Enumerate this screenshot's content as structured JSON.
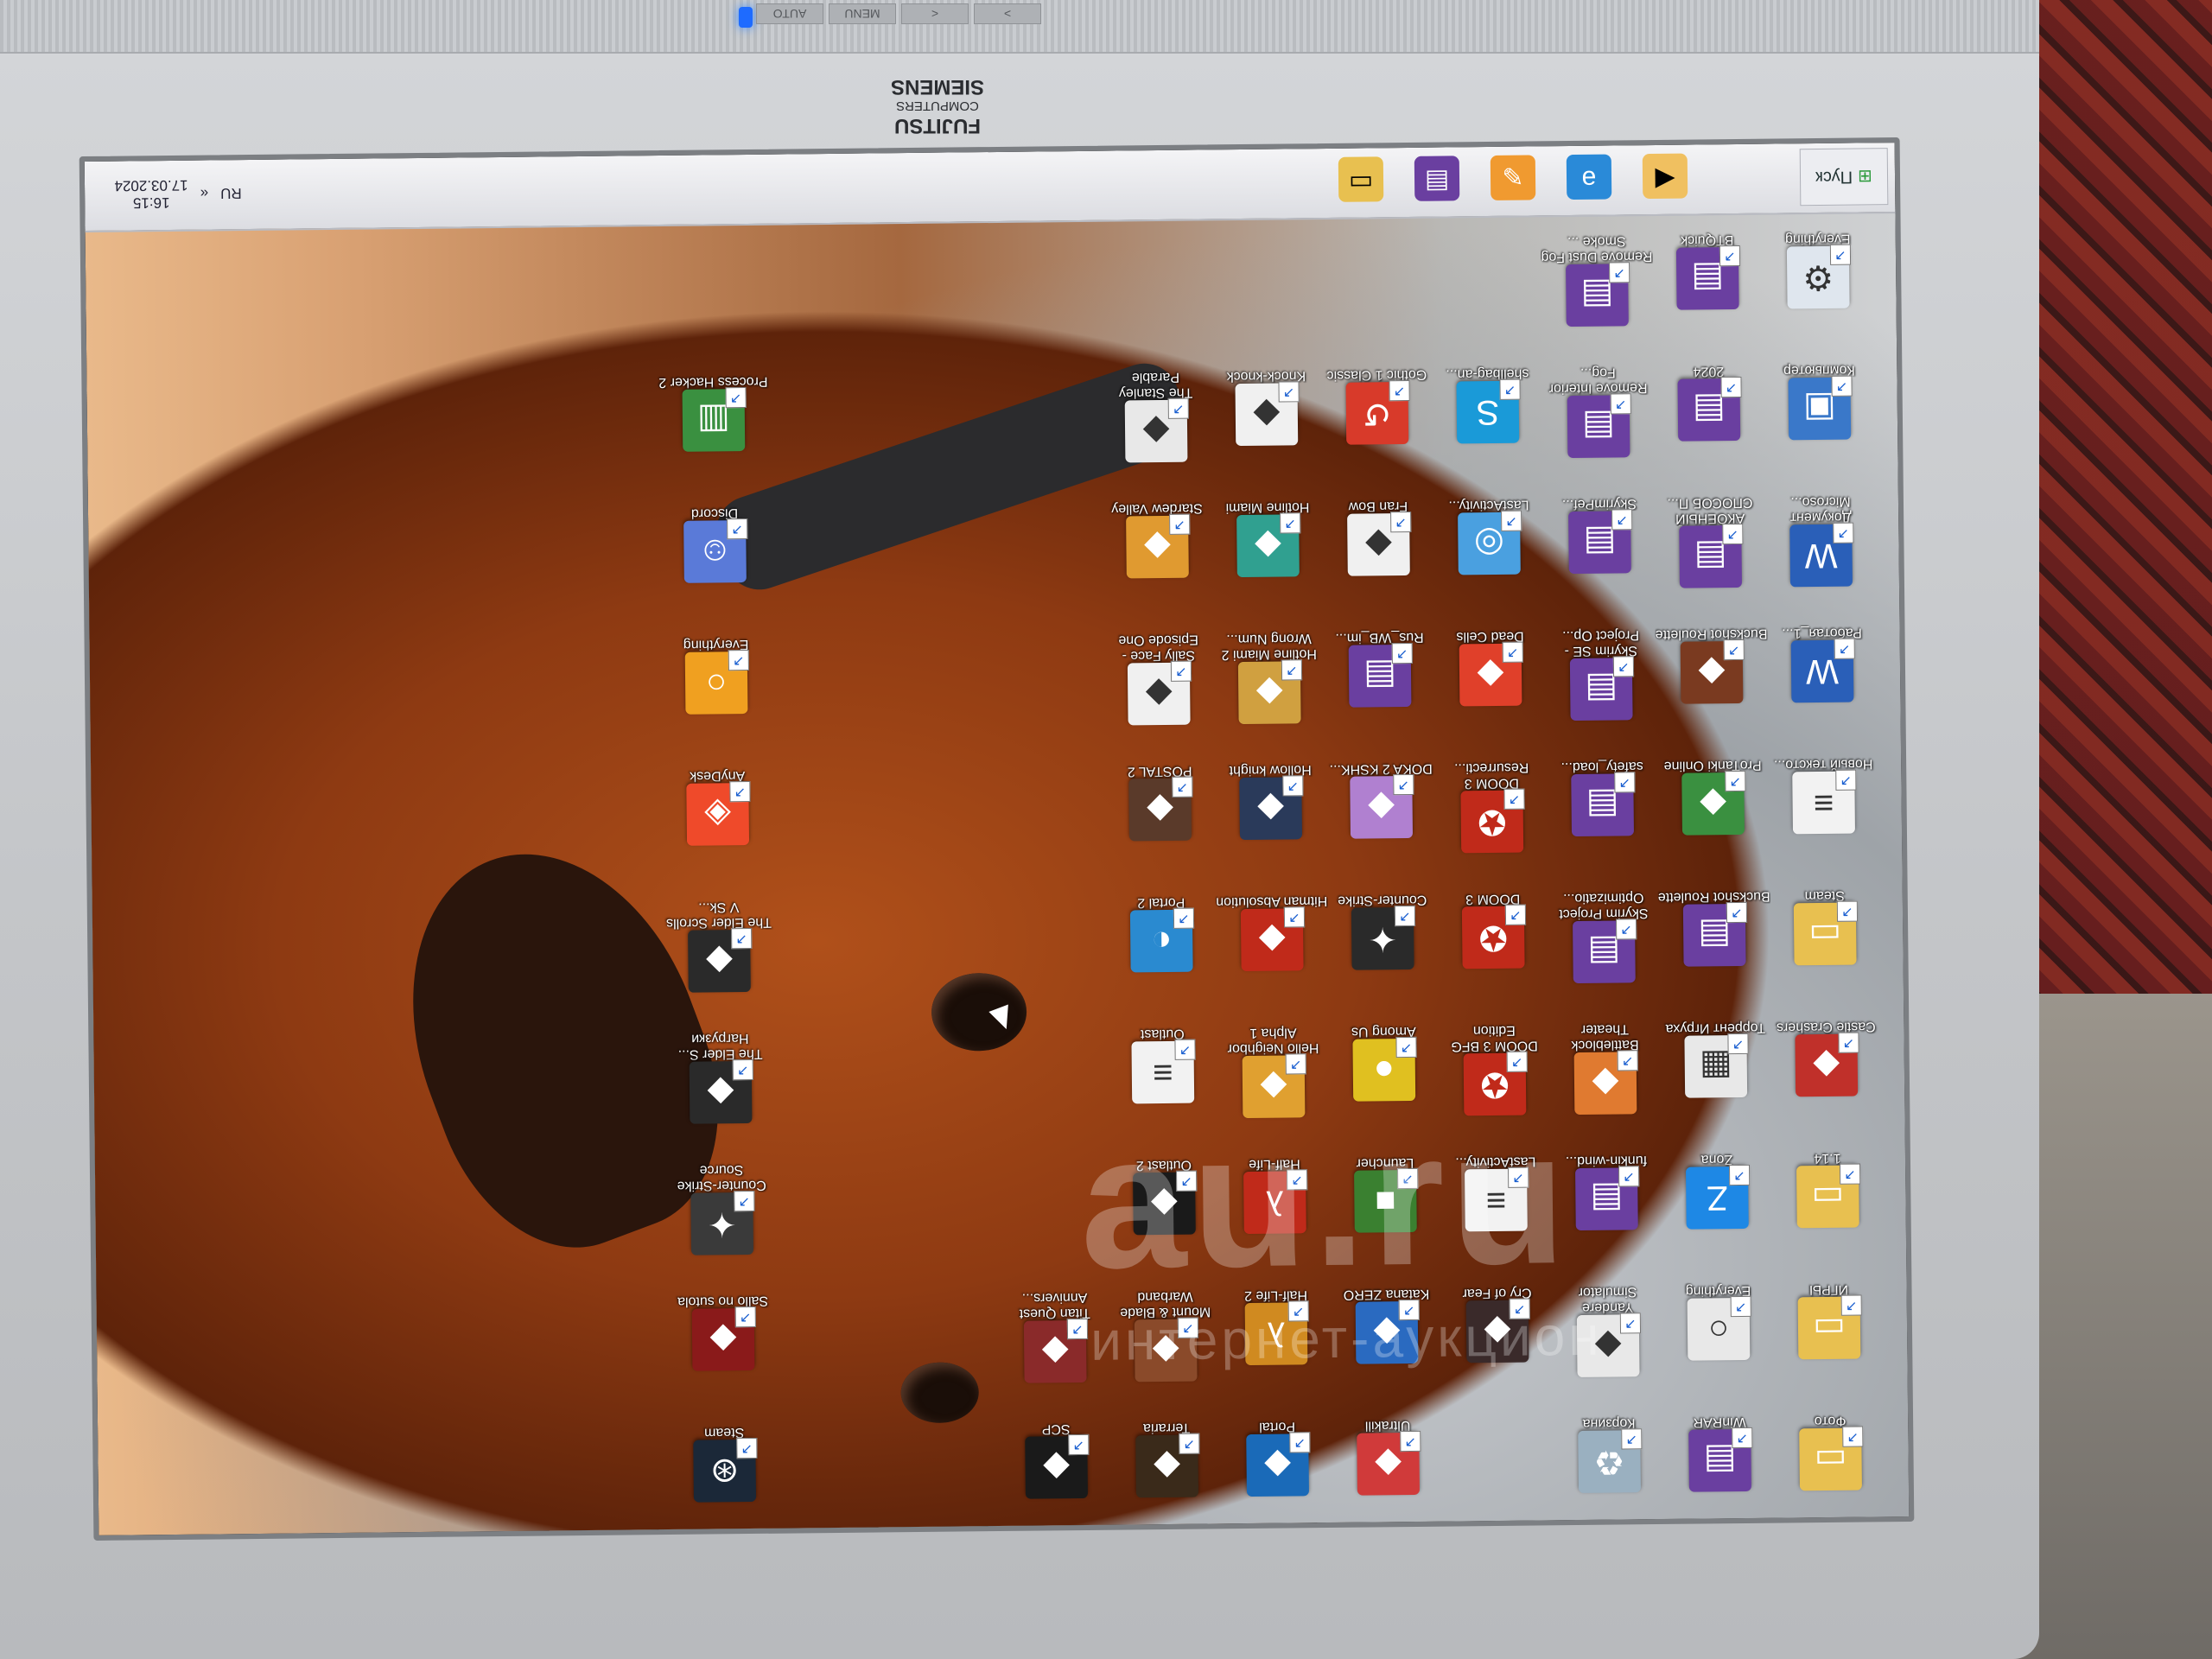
{
  "monitor": {
    "brand_lines": [
      "FUJITSU",
      "COMPUTERS",
      "SIEMENS"
    ],
    "bezel_buttons": [
      "AUTO",
      "MENU",
      "<",
      ">"
    ]
  },
  "taskbar": {
    "start_label": "Пуск",
    "tray_lang": "RU",
    "time": "16:15",
    "date": "17.03.2024",
    "quick_launch": [
      "folder-icon",
      "winrar-icon",
      "paint-icon",
      "ie-icon",
      "media-icon"
    ]
  },
  "watermark": {
    "main": "au.ru",
    "sub": "интернет-аукцион"
  },
  "desktop_icons": [
    {
      "label": "Everything",
      "icon": "gear-icon",
      "color": "#dfe6ee",
      "col": 0,
      "row": 0
    },
    {
      "label": "Компьютер",
      "icon": "computer-icon",
      "color": "#3a78c9",
      "col": 0,
      "row": 1
    },
    {
      "label": "Документ Microso...",
      "icon": "word-icon",
      "color": "#2a5fb8",
      "col": 0,
      "row": 2
    },
    {
      "label": "Работая_1...",
      "icon": "word-icon",
      "color": "#2a5fb8",
      "col": 0,
      "row": 3
    },
    {
      "label": "Новый тексто...",
      "icon": "text-file-icon",
      "color": "#f2f2f2",
      "col": 0,
      "row": 4
    },
    {
      "label": "Steam",
      "icon": "folder-icon",
      "color": "#e8c050",
      "col": 0,
      "row": 5
    },
    {
      "label": "Castle Crashers",
      "icon": "game-icon",
      "color": "#c0302a",
      "col": 0,
      "row": 6
    },
    {
      "label": "1.14",
      "icon": "folder-icon",
      "color": "#e8c050",
      "col": 0,
      "row": 7
    },
    {
      "label": "ИГРЫ",
      "icon": "folder-icon",
      "color": "#e8c050",
      "col": 0,
      "row": 8
    },
    {
      "label": "Фото",
      "icon": "folder-icon",
      "color": "#e8c050",
      "col": 0,
      "row": 9
    },
    {
      "label": "BTQuick",
      "icon": "winrar-icon",
      "color": "#6a3fa0",
      "col": 1,
      "row": 0
    },
    {
      "label": "2024",
      "icon": "winrar-icon",
      "color": "#6a3fa0",
      "col": 1,
      "row": 1
    },
    {
      "label": "АКОЕНЫЙ СПОСОБ П...",
      "icon": "winrar-icon",
      "color": "#6a3fa0",
      "col": 1,
      "row": 2
    },
    {
      "label": "Buckshot Roulette",
      "icon": "game-icon",
      "color": "#7a3a20",
      "col": 1,
      "row": 3
    },
    {
      "label": "ProTanki Online",
      "icon": "game-icon",
      "color": "#3a9040",
      "col": 1,
      "row": 4
    },
    {
      "label": "Buckshot Roulette",
      "icon": "winrar-icon",
      "color": "#6a3fa0",
      "col": 1,
      "row": 5
    },
    {
      "label": "Торрент Игруха",
      "icon": "document-icon",
      "color": "#e8e8e8",
      "col": 1,
      "row": 6
    },
    {
      "label": "Zona",
      "icon": "zona-icon",
      "color": "#1e88e5",
      "col": 1,
      "row": 7
    },
    {
      "label": "Everything",
      "icon": "search-icon",
      "color": "#e8e8e8",
      "col": 1,
      "row": 8
    },
    {
      "label": "WinRAR",
      "icon": "winrar-icon",
      "color": "#6a3fa0",
      "col": 1,
      "row": 9
    },
    {
      "label": "Remove Dust Fog Smoke ...",
      "icon": "winrar-icon",
      "color": "#6a3fa0",
      "col": 2,
      "row": 0
    },
    {
      "label": "Remove Interior Fog...",
      "icon": "winrar-icon",
      "color": "#6a3fa0",
      "col": 2,
      "row": 1
    },
    {
      "label": "SkyrimPef...",
      "icon": "winrar-icon",
      "color": "#6a3fa0",
      "col": 2,
      "row": 2
    },
    {
      "label": "Skyrim SE - Project Op...",
      "icon": "winrar-icon",
      "color": "#6a3fa0",
      "col": 2,
      "row": 3
    },
    {
      "label": "safety_load...",
      "icon": "winrar-icon",
      "color": "#6a3fa0",
      "col": 2,
      "row": 4
    },
    {
      "label": "Skyrim Project Optimizatio...",
      "icon": "winrar-icon",
      "color": "#6a3fa0",
      "col": 2,
      "row": 5
    },
    {
      "label": "Battleblock Theater",
      "icon": "game-icon",
      "color": "#e07a30",
      "col": 2,
      "row": 6
    },
    {
      "label": "funkin-wind...",
      "icon": "winrar-icon",
      "color": "#6a3fa0",
      "col": 2,
      "row": 7
    },
    {
      "label": "Yandere Simulator",
      "icon": "game-icon",
      "color": "#e8e8e8",
      "col": 2,
      "row": 8
    },
    {
      "label": "Корзина",
      "icon": "recycle-bin-icon",
      "color": "#9ab0c0",
      "col": 2,
      "row": 9
    },
    {
      "label": "shellbag-an...",
      "icon": "shellbag-icon",
      "color": "#1a9ad8",
      "col": 3,
      "row": 1
    },
    {
      "label": "LastActivity...",
      "icon": "activity-icon",
      "color": "#4aa0e0",
      "col": 3,
      "row": 2
    },
    {
      "label": "Dead Cells",
      "icon": "game-icon",
      "color": "#e0402a",
      "col": 3,
      "row": 3
    },
    {
      "label": "DOOM 3 Resurrecti...",
      "icon": "pentagram-icon",
      "color": "#c02a1a",
      "col": 3,
      "row": 4
    },
    {
      "label": "DOOM 3",
      "icon": "pentagram-icon",
      "color": "#c02a1a",
      "col": 3,
      "row": 5
    },
    {
      "label": "DOOM 3 BFG Edition",
      "icon": "pentagram-icon",
      "color": "#c02a1a",
      "col": 3,
      "row": 6
    },
    {
      "label": "LastActivity...",
      "icon": "text-file-icon",
      "color": "#f2f2f2",
      "col": 3,
      "row": 7
    },
    {
      "label": "Cry of Fear",
      "icon": "game-icon",
      "color": "#3a2a2a",
      "col": 3,
      "row": 8
    },
    {
      "label": "Gothic 1 Classic",
      "icon": "gothic-icon",
      "color": "#d83a2a",
      "col": 4,
      "row": 1
    },
    {
      "label": "Fran Bow",
      "icon": "game-icon",
      "color": "#f0f0f0",
      "col": 4,
      "row": 2
    },
    {
      "label": "Rus_WB_im...",
      "icon": "winrar-icon",
      "color": "#6a3fa0",
      "col": 4,
      "row": 3
    },
    {
      "label": "DOKA 2 KSHK...",
      "icon": "game-icon",
      "color": "#b080d0",
      "col": 4,
      "row": 4
    },
    {
      "label": "Counter-Strike",
      "icon": "cs-icon",
      "color": "#2a2a2a",
      "col": 4,
      "row": 5
    },
    {
      "label": "Among Us",
      "icon": "among-us-icon",
      "color": "#e0c020",
      "col": 4,
      "row": 6
    },
    {
      "label": "Launcher",
      "icon": "minecraft-icon",
      "color": "#3a8030",
      "col": 4,
      "row": 7
    },
    {
      "label": "Katana ZERO",
      "icon": "game-icon",
      "color": "#2a6ac0",
      "col": 4,
      "row": 8
    },
    {
      "label": "Ultrakill",
      "icon": "game-icon",
      "color": "#d03a3a",
      "col": 4,
      "row": 9
    },
    {
      "label": "Knock-knock",
      "icon": "game-icon",
      "color": "#f0f0f0",
      "col": 5,
      "row": 1
    },
    {
      "label": "Hotline Miami",
      "icon": "game-icon",
      "color": "#30a090",
      "col": 5,
      "row": 2
    },
    {
      "label": "Hotline Miami 2 Wrong Num...",
      "icon": "game-icon",
      "color": "#d0a040",
      "col": 5,
      "row": 3
    },
    {
      "label": "Hollow knight",
      "icon": "game-icon",
      "color": "#2a3a5a",
      "col": 5,
      "row": 4
    },
    {
      "label": "Hitman Absolution",
      "icon": "game-icon",
      "color": "#c02a1a",
      "col": 5,
      "row": 5
    },
    {
      "label": "Hello Neighbor Alpha 1",
      "icon": "game-icon",
      "color": "#e0a030",
      "col": 5,
      "row": 6
    },
    {
      "label": "Half-Life",
      "icon": "half-life-icon",
      "color": "#c02a1a",
      "col": 5,
      "row": 7
    },
    {
      "label": "Half-Life 2",
      "icon": "half-life-icon",
      "color": "#d08a20",
      "col": 5,
      "row": 8
    },
    {
      "label": "Portal",
      "icon": "game-icon",
      "color": "#1a6ab8",
      "col": 5,
      "row": 9
    },
    {
      "label": "The Stanley Parable",
      "icon": "game-icon",
      "color": "#e8e8e8",
      "col": 6,
      "row": 1
    },
    {
      "label": "Stardew Valley",
      "icon": "game-icon",
      "color": "#e09a30",
      "col": 6,
      "row": 2
    },
    {
      "label": "Sally Face - Episode One",
      "icon": "game-icon",
      "color": "#f0f0f0",
      "col": 6,
      "row": 3
    },
    {
      "label": "POSTAL 2",
      "icon": "game-icon",
      "color": "#5a3a2a",
      "col": 6,
      "row": 4
    },
    {
      "label": "Portal 2",
      "icon": "portal-icon",
      "color": "#2a8ad0",
      "col": 6,
      "row": 5
    },
    {
      "label": "Outlast",
      "icon": "text-file-icon",
      "color": "#f2f2f2",
      "col": 6,
      "row": 6
    },
    {
      "label": "Outlast 2",
      "icon": "game-icon",
      "color": "#1a1a1a",
      "col": 6,
      "row": 7
    },
    {
      "label": "Mount & Blade Warband",
      "icon": "game-icon",
      "color": "#8a4a2a",
      "col": 6,
      "row": 8
    },
    {
      "label": "Terraria",
      "icon": "game-icon",
      "color": "#3a2a1a",
      "col": 6,
      "row": 9
    },
    {
      "label": "Titan Quest Annivers...",
      "icon": "game-icon",
      "color": "#8a2a2a",
      "col": 7,
      "row": 8
    },
    {
      "label": "SCP",
      "icon": "game-icon",
      "color": "#1a1a1a",
      "col": 7,
      "row": 9
    },
    {
      "label": "Process Hacker 2",
      "icon": "process-hacker-icon",
      "color": "#3a9040",
      "col": 10,
      "row": 1
    },
    {
      "label": "Discord",
      "icon": "discord-icon",
      "color": "#5a7ad8",
      "col": 10,
      "row": 2
    },
    {
      "label": "Everything",
      "icon": "search-icon",
      "color": "#f0a020",
      "col": 10,
      "row": 3
    },
    {
      "label": "AnyDesk",
      "icon": "anydesk-icon",
      "color": "#ef4a2a",
      "col": 10,
      "row": 4
    },
    {
      "label": "The Elder Scrolls V Sk...",
      "icon": "game-icon",
      "color": "#2a2a2a",
      "col": 10,
      "row": 5
    },
    {
      "label": "The Elder S... Нагрузки",
      "icon": "game-icon",
      "color": "#2a2a2a",
      "col": 10,
      "row": 6
    },
    {
      "label": "Counter-Strike Source",
      "icon": "cs-icon",
      "color": "#3a3a3a",
      "col": 10,
      "row": 7
    },
    {
      "label": "Sallo no sutola",
      "icon": "game-icon",
      "color": "#8a1a1a",
      "col": 10,
      "row": 8
    },
    {
      "label": "Steam",
      "icon": "steam-icon",
      "color": "#1b2838",
      "col": 10,
      "row": 9
    }
  ]
}
